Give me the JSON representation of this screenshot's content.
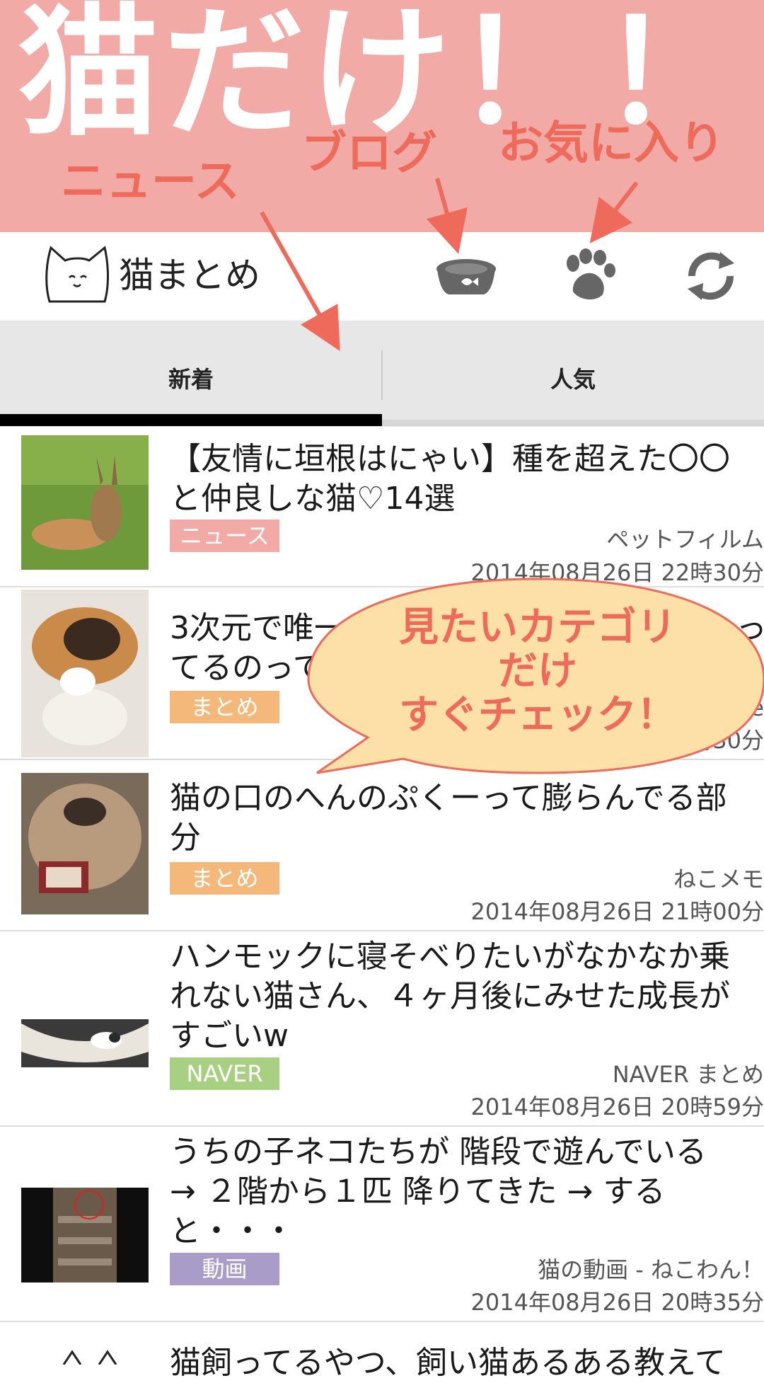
{
  "promo": {
    "title": "猫だけ！！",
    "label_news": "ニュース",
    "label_blog": "ブログ",
    "label_favorites": "お気に入り",
    "bubble_line1": "見たいカテゴリ",
    "bubble_line2": "だけ",
    "bubble_line3": "すぐチェック！"
  },
  "app": {
    "title": "猫まとめ",
    "actions": [
      "cat-bowl-icon",
      "paw-icon",
      "refresh-icon"
    ]
  },
  "tabs": [
    {
      "label": "新着",
      "selected": true
    },
    {
      "label": "人気",
      "selected": false
    }
  ],
  "colors": {
    "banner_bg": "#f2aaa6",
    "accent_red": "#ee6a5a",
    "badge_news": "#f2aaa6",
    "badge_matome": "#f4b97a",
    "badge_naver": "#a8cf82",
    "badge_video": "#a99cc8",
    "bubble_fill": "#fde0a8"
  },
  "articles": [
    {
      "title": "【友情に垣根はにゃい】種を超えた〇〇と仲良しな猫♡14選",
      "badge": "ニュース",
      "source": "ペットフィルム",
      "date": "2014年08月26日 22時30分"
    },
    {
      "title": "3次元で唯一〇",
      "title_line2": "てるのって",
      "title_tail1": "っ",
      "badge": "まとめ",
      "source_tail": "e",
      "date_tail": "時30分"
    },
    {
      "title": "猫の口のへんのぷくーって膨らんでる部分",
      "badge": "まとめ",
      "source": "ねこメモ",
      "date": "2014年08月26日 21時00分"
    },
    {
      "title": "ハンモックに寝そべりたいがなかなか乗れない猫さん、４ヶ月後にみせた成長がすごいw",
      "badge": "NAVER",
      "source": "NAVER まとめ",
      "date": "2014年08月26日 20時59分"
    },
    {
      "title": "うちの子ネコたちが 階段で遊んでいる → ２階から１匹 降りてきた → すると・・・",
      "badge": "動画",
      "source": "猫の動画 - ねこわん！",
      "date": "2014年08月26日 20時35分"
    },
    {
      "title": "猫飼ってるやつ、飼い猫あるある教えて"
    }
  ]
}
